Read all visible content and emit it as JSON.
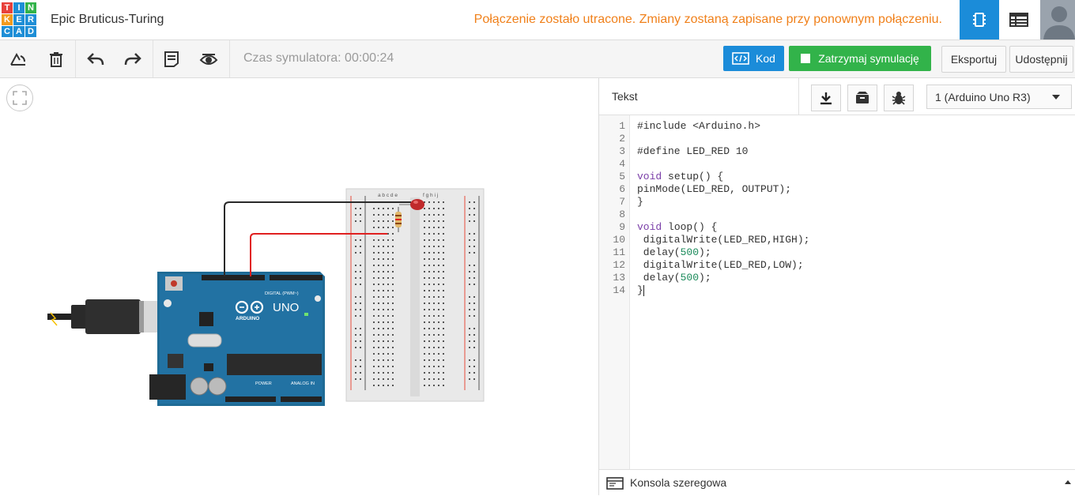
{
  "app": {
    "logo_letters": [
      "T",
      "I",
      "N",
      "K",
      "E",
      "R",
      "C",
      "A",
      "D"
    ],
    "project_title": "Epic Bruticus-Turing",
    "connection_warning": "Połączenie zostało utracone. Zmiany zostaną zapisane przy ponownym połączeniu.",
    "colors": {
      "warning": "#f0801a",
      "accent": "#1b8cd9",
      "simulate": "#32b34a"
    }
  },
  "toolbar": {
    "sim_time": "Czas symulatora: 00:00:24",
    "code_label": "Kod",
    "stop_sim_label": "Zatrzymaj symulację",
    "export_label": "Eksportuj",
    "share_label": "Udostępnij",
    "icons": [
      "rotate-icon",
      "delete-icon",
      "undo-icon",
      "redo-icon",
      "notes-icon",
      "visibility-icon"
    ]
  },
  "board": {
    "brand": "ARDUINO",
    "model": "UNO",
    "digital_label": "DIGITAL (PWM~)",
    "power_label": "POWER",
    "analog_label": "ANALOG IN",
    "breadboard_cols_left": "a b c d e",
    "breadboard_cols_right": "f g h i j"
  },
  "code_panel": {
    "mode_label": "Tekst",
    "board_select": "1 (Arduino Uno R3)",
    "line_numbers": [
      "1",
      "2",
      "3",
      "4",
      "5",
      "6",
      "7",
      "8",
      "9",
      "10",
      "11",
      "12",
      "13",
      "14"
    ],
    "code": [
      "#include <Arduino.h>",
      "",
      "#define LED_RED 10",
      "",
      "void setup() {",
      "pinMode(LED_RED, OUTPUT);",
      "}",
      "",
      "void loop() {",
      " digitalWrite(LED_RED,HIGH);",
      " delay(500);",
      " digitalWrite(LED_RED,LOW);",
      " delay(500);",
      "}"
    ],
    "console_label": "Konsola szeregowa"
  }
}
